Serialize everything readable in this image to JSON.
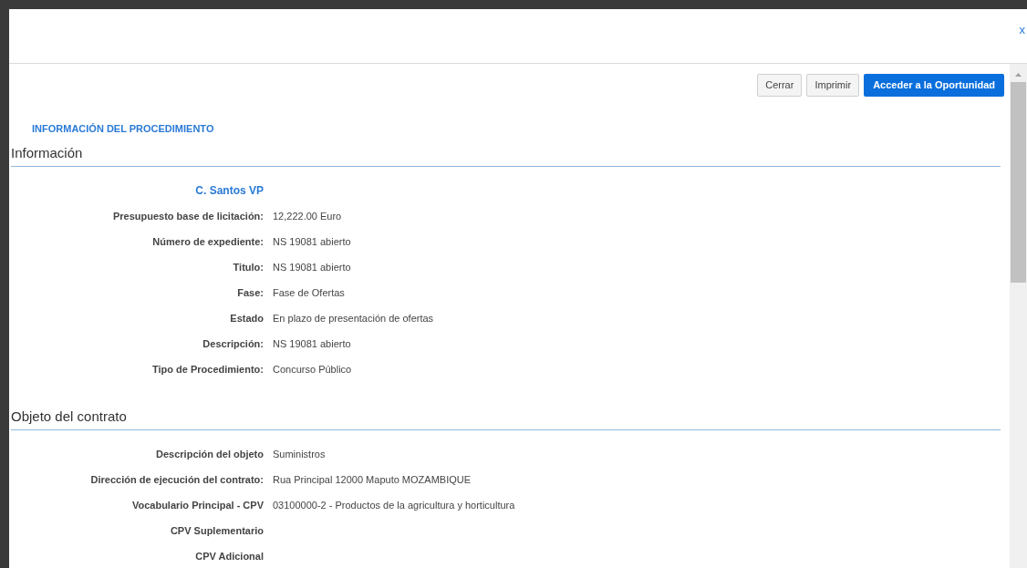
{
  "dialog": {
    "close": "x"
  },
  "buttons": [
    {
      "label": "Cerrar",
      "kind": "secondary"
    },
    {
      "label": "Imprimir",
      "kind": "secondary"
    },
    {
      "label": "Acceder a la Oportunidad",
      "kind": "primary"
    }
  ],
  "title": "INFORMACIÓN DEL PROCEDIMIENTO",
  "sections": [
    {
      "heading": "Información",
      "fields": [
        {
          "kind": "name",
          "label": "C. Santos VP"
        },
        {
          "kind": "field",
          "label": "Presupuesto base de licitación:",
          "value": "12,222.00 Euro"
        },
        {
          "kind": "field",
          "label": "Número de expediente:",
          "value": "NS 19081 abierto"
        },
        {
          "kind": "field",
          "label": "Titulo:",
          "value": "NS 19081 abierto"
        },
        {
          "kind": "field",
          "label": "Fase:",
          "value": "Fase de Ofertas"
        },
        {
          "kind": "field",
          "label": "Estado",
          "value": "En plazo de presentación de ofertas"
        },
        {
          "kind": "field",
          "label": "Descripción:",
          "value": "NS 19081 abierto"
        },
        {
          "kind": "field",
          "label": "Tipo de Procedimiento:",
          "value": "Concurso Público"
        }
      ]
    },
    {
      "heading": "Objeto del contrato",
      "fields": [
        {
          "kind": "field",
          "label": "Descripción del objeto",
          "value": "Suministros"
        },
        {
          "kind": "field",
          "label": "Dirección de ejecución del contrato:",
          "value": "Rua Principal 12000 Maputo MOZAMBIQUE"
        },
        {
          "kind": "field",
          "label": "Vocabulario Principal - CPV",
          "value": "03100000-2 - Productos de la agricultura y horticultura"
        },
        {
          "kind": "field",
          "label": "CPV Suplementario"
        },
        {
          "kind": "field",
          "label": "CPV Adicional"
        }
      ]
    }
  ]
}
